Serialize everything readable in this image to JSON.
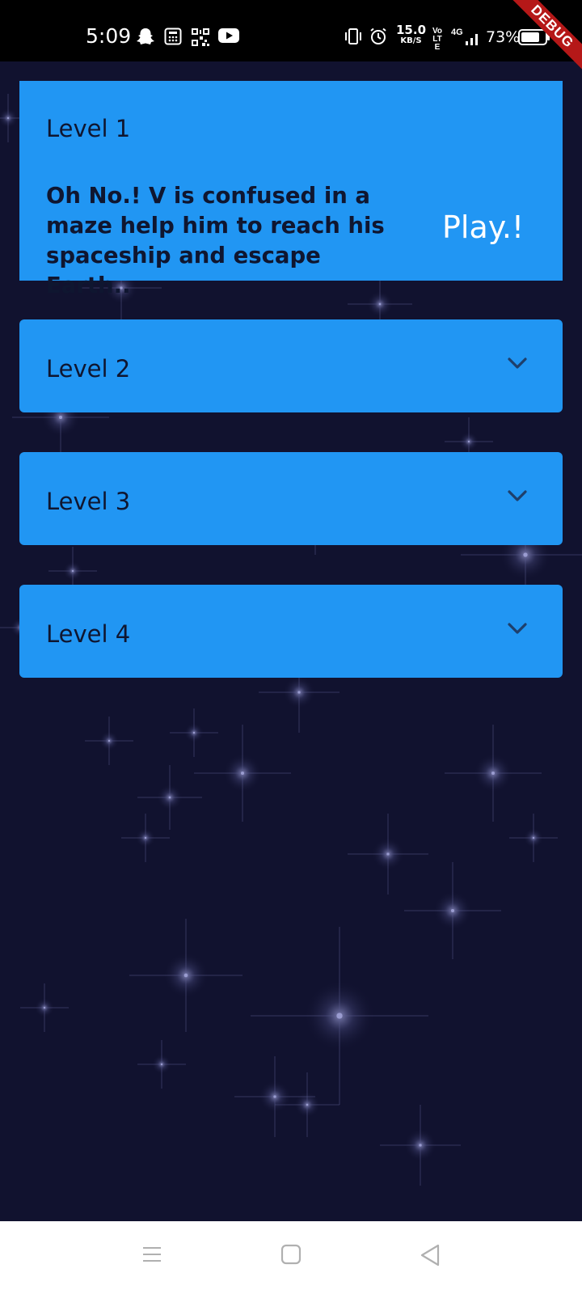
{
  "status_bar": {
    "time": "5:09",
    "speed_value": "15.0",
    "speed_unit": "KB/S",
    "volte": "Vo LTE",
    "network": "4G",
    "battery": "73%",
    "debug_label": "DEBUG",
    "icons": [
      "snapchat-icon",
      "calculator-icon",
      "qr-icon",
      "youtube-icon",
      "vibrate-icon",
      "alarm-icon",
      "signal-icon",
      "battery-icon"
    ]
  },
  "levels": [
    {
      "title": "Level 1",
      "expanded": true,
      "description": "Oh No.! V is confused in a maze help him to reach his spaceship and escape Earth..",
      "action_label": "Play.!"
    },
    {
      "title": "Level 2",
      "expanded": false,
      "icon": "chevron-down-icon"
    },
    {
      "title": "Level 3",
      "expanded": false,
      "icon": "chevron-down-icon"
    },
    {
      "title": "Level 4",
      "expanded": false,
      "icon": "chevron-down-icon"
    }
  ],
  "nav_bar": {
    "icons": [
      "menu-icon",
      "home-icon",
      "back-icon"
    ]
  },
  "colors": {
    "background": "#11122f",
    "card": "#2196f3",
    "card_text": "#0f1630",
    "play_text": "#ffffff",
    "debug_banner": "#b51818"
  }
}
